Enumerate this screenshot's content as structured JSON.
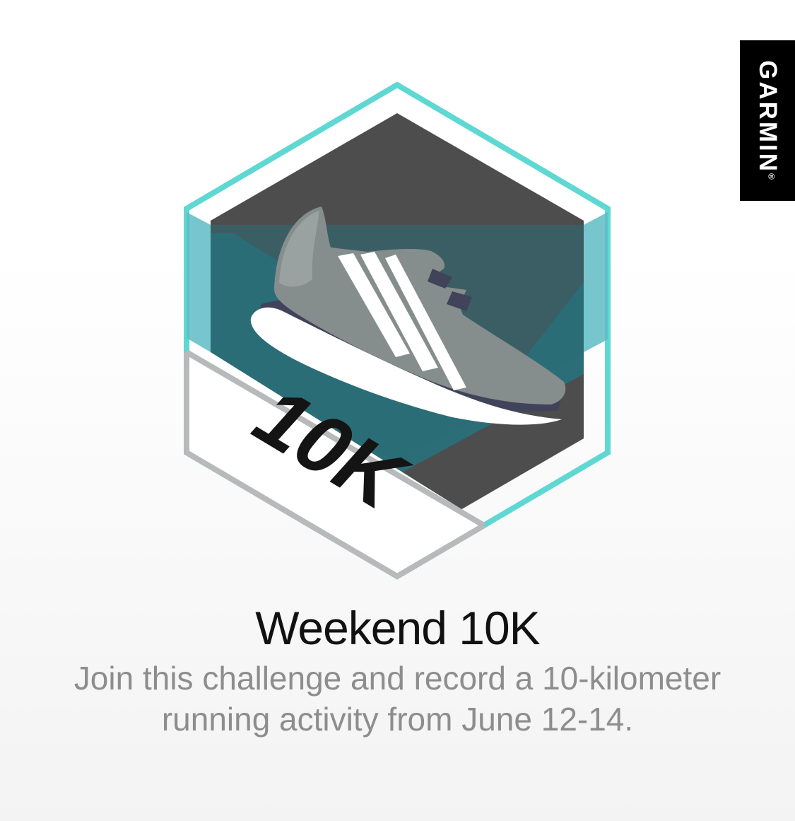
{
  "brand": {
    "name": "GARMIN",
    "mark": "®"
  },
  "badge": {
    "label": "10K",
    "icon": "running-shoe-icon",
    "colors": {
      "frame": "#5fd8d3",
      "band": "#2b6e77",
      "core": "#4d4d4d",
      "shoe": "#868d8d",
      "ribbon": "#ffffff",
      "ribbon_border": "#b7b9bb"
    }
  },
  "challenge": {
    "title": "Weekend 10K",
    "description": "Join this challenge and record a 10-kilometer running activity from June 12-14."
  }
}
